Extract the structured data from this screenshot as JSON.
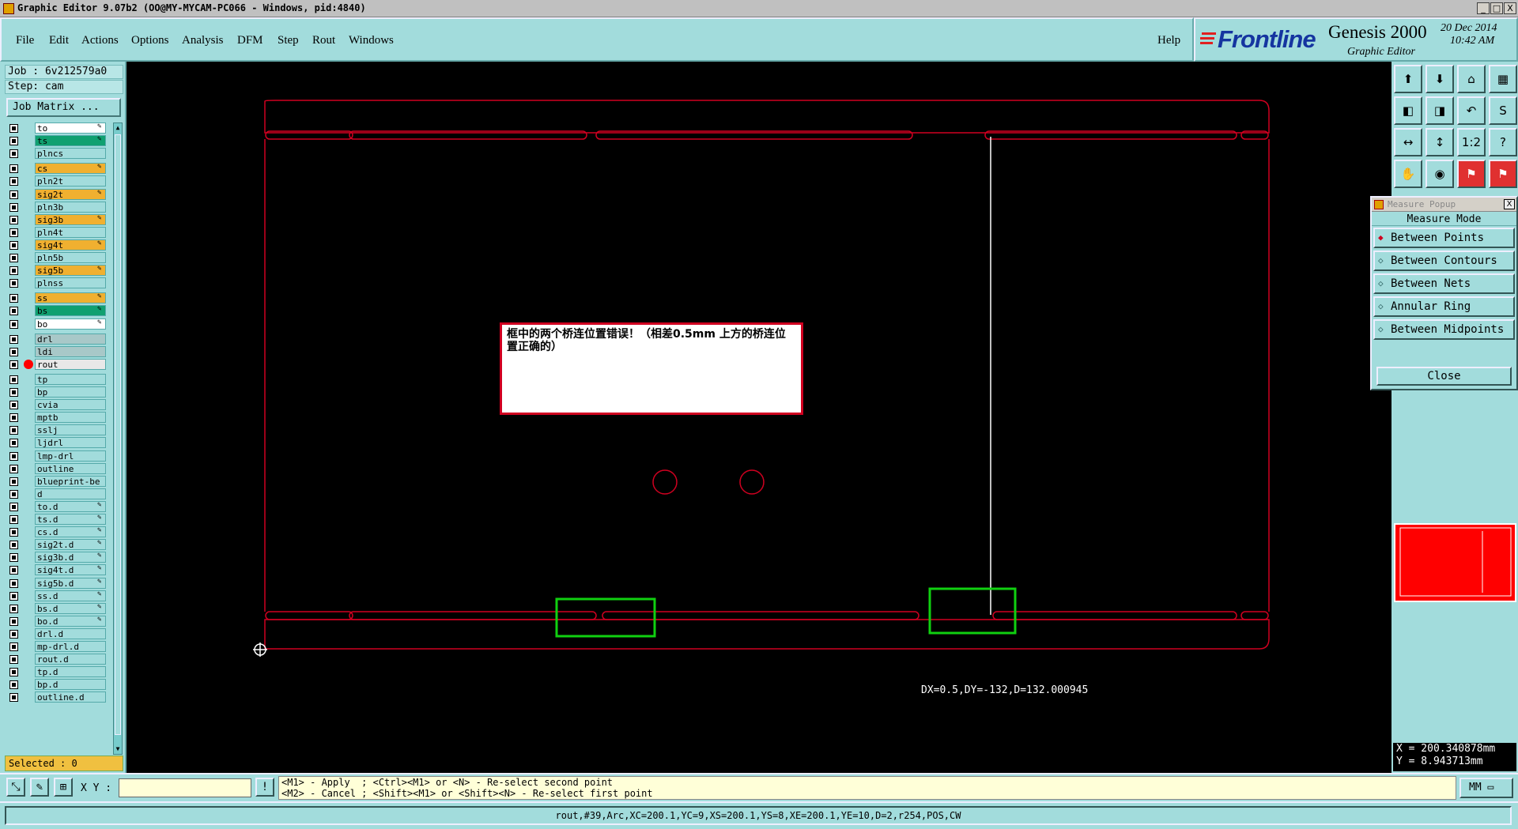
{
  "window": {
    "title": "Graphic Editor 9.07b2 (OO@MY-MYCAM-PC066 - Windows, pid:4840)",
    "min_label": "_",
    "max_label": "□",
    "close_label": "X"
  },
  "menu": {
    "items": [
      "File",
      "Edit",
      "Actions",
      "Options",
      "Analysis",
      "DFM",
      "Step",
      "Rout",
      "Windows"
    ],
    "help": "Help"
  },
  "brand": {
    "logo": "Frontline",
    "product": "Genesis 2000",
    "subtitle": "Graphic Editor",
    "date": "20 Dec 2014",
    "time": "10:42 AM"
  },
  "job": {
    "job_line": "Job : 6v212579a0",
    "step_line": "Step: cam",
    "matrix_button": "Job Matrix ..."
  },
  "layers": [
    {
      "name": "to",
      "color": "#ffffff",
      "pen": true
    },
    {
      "name": "ts",
      "color": "#10a070",
      "pen": true
    },
    {
      "name": "plncs",
      "color": "#a2dcdc",
      "pen": false
    },
    {
      "name": "cs",
      "color": "#f0b030",
      "pen": true
    },
    {
      "name": "pln2t",
      "color": "#a2dcdc",
      "pen": false
    },
    {
      "name": "sig2t",
      "color": "#f0b030",
      "pen": true
    },
    {
      "name": "pln3b",
      "color": "#a2dcdc",
      "pen": false
    },
    {
      "name": "sig3b",
      "color": "#f0b030",
      "pen": true
    },
    {
      "name": "pln4t",
      "color": "#a2dcdc",
      "pen": false
    },
    {
      "name": "sig4t",
      "color": "#f0b030",
      "pen": true
    },
    {
      "name": "pln5b",
      "color": "#a2dcdc",
      "pen": false
    },
    {
      "name": "sig5b",
      "color": "#f0b030",
      "pen": true
    },
    {
      "name": "plnss",
      "color": "#a2dcdc",
      "pen": false
    },
    {
      "name": "ss",
      "color": "#f0b030",
      "pen": true
    },
    {
      "name": "bs",
      "color": "#10a070",
      "pen": true
    },
    {
      "name": "bo",
      "color": "#ffffff",
      "pen": true
    },
    {
      "name": "drl",
      "color": "#a8c8c8",
      "pen": false
    },
    {
      "name": "ldi",
      "color": "#a8c8c8",
      "pen": false
    },
    {
      "name": "rout",
      "color": "#e8e8e8",
      "pen": false,
      "active": true
    },
    {
      "name": "tp",
      "color": "#a2dcdc",
      "pen": false
    },
    {
      "name": "bp",
      "color": "#a2dcdc",
      "pen": false
    },
    {
      "name": "cvia",
      "color": "#a2dcdc",
      "pen": false
    },
    {
      "name": "mptb",
      "color": "#a2dcdc",
      "pen": false
    },
    {
      "name": "sslj",
      "color": "#a2dcdc",
      "pen": false
    },
    {
      "name": "ljdrl",
      "color": "#a2dcdc",
      "pen": false
    },
    {
      "name": "lmp-drl",
      "color": "#a2dcdc",
      "pen": false
    },
    {
      "name": "outline",
      "color": "#a2dcdc",
      "pen": false
    },
    {
      "name": "blueprint-be",
      "color": "#a2dcdc",
      "pen": false
    },
    {
      "name": "d",
      "color": "#a2dcdc",
      "pen": false
    },
    {
      "name": "to.d",
      "color": "#a2dcdc",
      "pen": true
    },
    {
      "name": "ts.d",
      "color": "#a2dcdc",
      "pen": true
    },
    {
      "name": "cs.d",
      "color": "#a2dcdc",
      "pen": true
    },
    {
      "name": "sig2t.d",
      "color": "#a2dcdc",
      "pen": true
    },
    {
      "name": "sig3b.d",
      "color": "#a2dcdc",
      "pen": true
    },
    {
      "name": "sig4t.d",
      "color": "#a2dcdc",
      "pen": true
    },
    {
      "name": "sig5b.d",
      "color": "#a2dcdc",
      "pen": true
    },
    {
      "name": "ss.d",
      "color": "#a2dcdc",
      "pen": true
    },
    {
      "name": "bs.d",
      "color": "#a2dcdc",
      "pen": true
    },
    {
      "name": "bo.d",
      "color": "#a2dcdc",
      "pen": true
    },
    {
      "name": "drl.d",
      "color": "#a2dcdc",
      "pen": false
    },
    {
      "name": "mp-drl.d",
      "color": "#a2dcdc",
      "pen": false
    },
    {
      "name": "rout.d",
      "color": "#a2dcdc",
      "pen": false
    },
    {
      "name": "tp.d",
      "color": "#a2dcdc",
      "pen": false
    },
    {
      "name": "bp.d",
      "color": "#a2dcdc",
      "pen": false
    },
    {
      "name": "outline.d",
      "color": "#a2dcdc",
      "pen": false
    }
  ],
  "selected": "Selected : 0",
  "canvas": {
    "note": "框中的两个桥连位置错误！（相差0.5mm 上方的桥连位置正确的）",
    "measure": "DX=0.5,DY=-132,D=132.000945"
  },
  "toolbar_icons": [
    "open-job-icon",
    "save-job-icon",
    "home-icon",
    "layout-icon",
    "fit-left-icon",
    "fit-right-icon",
    "undo-zoom-icon",
    "snap-icon",
    "fit-width-icon",
    "fit-height-icon",
    "ratio-icon",
    "help-icon",
    "snapshot-icon",
    "target-icon",
    "layer-red-icon",
    "layer-red2-icon"
  ],
  "toolbar_labels": [
    "⬆",
    "⬇",
    "⌂",
    "▦",
    "◧",
    "◨",
    "↶",
    "S",
    "↔",
    "↕",
    "1:2",
    "?",
    "✋",
    "◉",
    "⚑",
    "⚑"
  ],
  "measure_popup": {
    "title": "Measure Popup",
    "close_x": "X",
    "mode_label": "Measure Mode",
    "options": [
      "Between Points",
      "Between Contours",
      "Between Nets",
      "Annular Ring",
      "Between Midpoints"
    ],
    "selected_option": "Between Points",
    "close_button": "Close"
  },
  "coords": {
    "x": "X = 200.340878mm",
    "y": "Y = 8.943713mm"
  },
  "bottom": {
    "xy_label": "X Y :",
    "xy_value": "",
    "hint_line1": "<M1> - Apply  ; <Ctrl><M1> or <N> - Re-select second point",
    "hint_line2": "<M2> - Cancel ; <Shift><M1> or <Shift><N> - Re-select first point",
    "units": "MM",
    "excl": "!"
  },
  "status": "rout,#39,Arc,XC=200.1,YC=9,XS=200.1,YS=8,XE=200.1,YE=10,D=2,r254,POS,CW",
  "colors": {
    "panel": "#a2dcdc",
    "rout_line": "#d00020",
    "highlight_box": "#10d010",
    "canvas_bg": "#000000"
  }
}
